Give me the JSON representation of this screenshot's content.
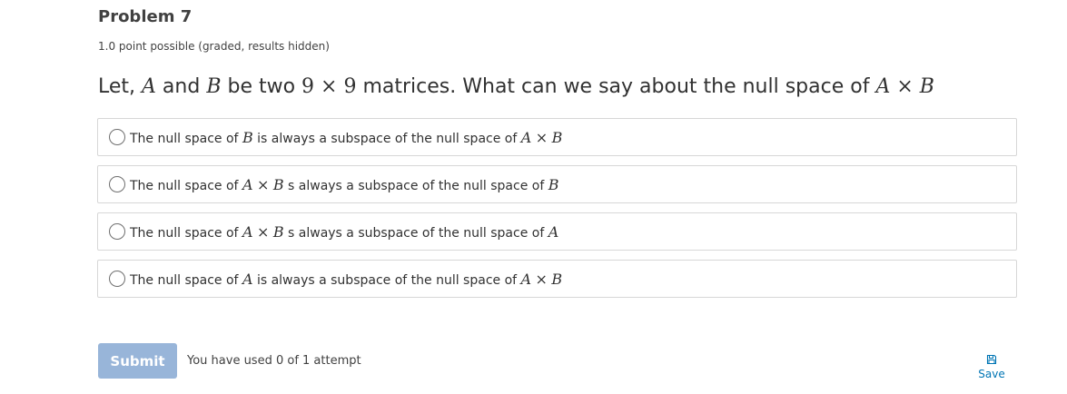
{
  "problem": {
    "title": "Problem 7",
    "points": "1.0 point possible (graded, results hidden)"
  },
  "question": {
    "p1": "Let, ",
    "var_a": "A",
    "p2": " and ",
    "var_b": "B",
    "p3": " be two ",
    "num1": "9",
    "times": "×",
    "num2": "9",
    "p4": " matrices. What can we say about the null space of ",
    "var_a2": "A",
    "times2": "×",
    "var_b2": "B"
  },
  "options": [
    {
      "t1": "The null space of ",
      "m1": "B",
      "t2": " is always a subspace of the null space of ",
      "m2a": "A",
      "m2op": "×",
      "m2b": "B"
    },
    {
      "t1": "The null space of ",
      "m1a": "A",
      "m1op": "×",
      "m1b": "B",
      "t2": " s always a subspace of the null space of ",
      "m2": "B"
    },
    {
      "t1": "The null space of ",
      "m1a": "A",
      "m1op": "×",
      "m1b": "B",
      "t2": " s always a subspace of the null space of ",
      "m2": "A"
    },
    {
      "t1": "The null space of ",
      "m1": "A",
      "t2": " is always a subspace of the null space of ",
      "m2a": "A",
      "m2op": "×",
      "m2b": "B"
    }
  ],
  "footer": {
    "submit_label": "Submit",
    "attempts_text": "You have used 0 of 1 attempt",
    "save_label": "Save",
    "save_icon": "floppy-disk-icon"
  },
  "colors": {
    "submit_bg": "#98b5d9",
    "link": "#0075b4",
    "border": "#d7d7d7"
  }
}
